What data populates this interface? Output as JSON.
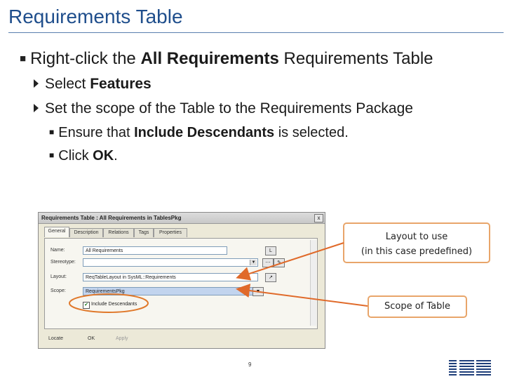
{
  "slide": {
    "title": "Requirements Table",
    "b1_prefix": "Right-click the ",
    "b1_bold": "All Requirements",
    "b1_suffix": " Requirements Table",
    "b2_prefix": "Select ",
    "b2_bold": "Features",
    "b3": "Set the scope of the Table to the Requirements Package",
    "b4_prefix": "Ensure that ",
    "b4_bold": "Include Descendants",
    "b4_suffix": " is selected.",
    "b5_prefix": "Click ",
    "b5_bold": "OK",
    "b5_suffix": ".",
    "page_number": "9"
  },
  "dialog": {
    "title": "Requirements Table : All Requirements in TablesPkg",
    "close": "x",
    "tabs": [
      "General",
      "Description",
      "Relations",
      "Tags",
      "Properties"
    ],
    "name_label": "Name:",
    "name_value": "All Requirements",
    "stereotype_label": "Stereotype:",
    "layout_label": "Layout:",
    "layout_value": "ReqTableLayout in SysML::Requirements",
    "scope_label": "Scope:",
    "scope_value": "RequirementsPkg",
    "include_desc": "Include Descendants",
    "locate": "Locate",
    "ok": "OK",
    "apply": "Apply",
    "l_btn": "L"
  },
  "callouts": {
    "layout_line1": "Layout to use",
    "layout_line2": "(in this case predefined)",
    "scope": "Scope of Table"
  },
  "logo": {
    "text": "IBM"
  },
  "colors": {
    "title": "#1f4e8c",
    "callout_border": "#e8a56a",
    "arrow": "#e06a2a",
    "ellipse": "#e0782a"
  }
}
